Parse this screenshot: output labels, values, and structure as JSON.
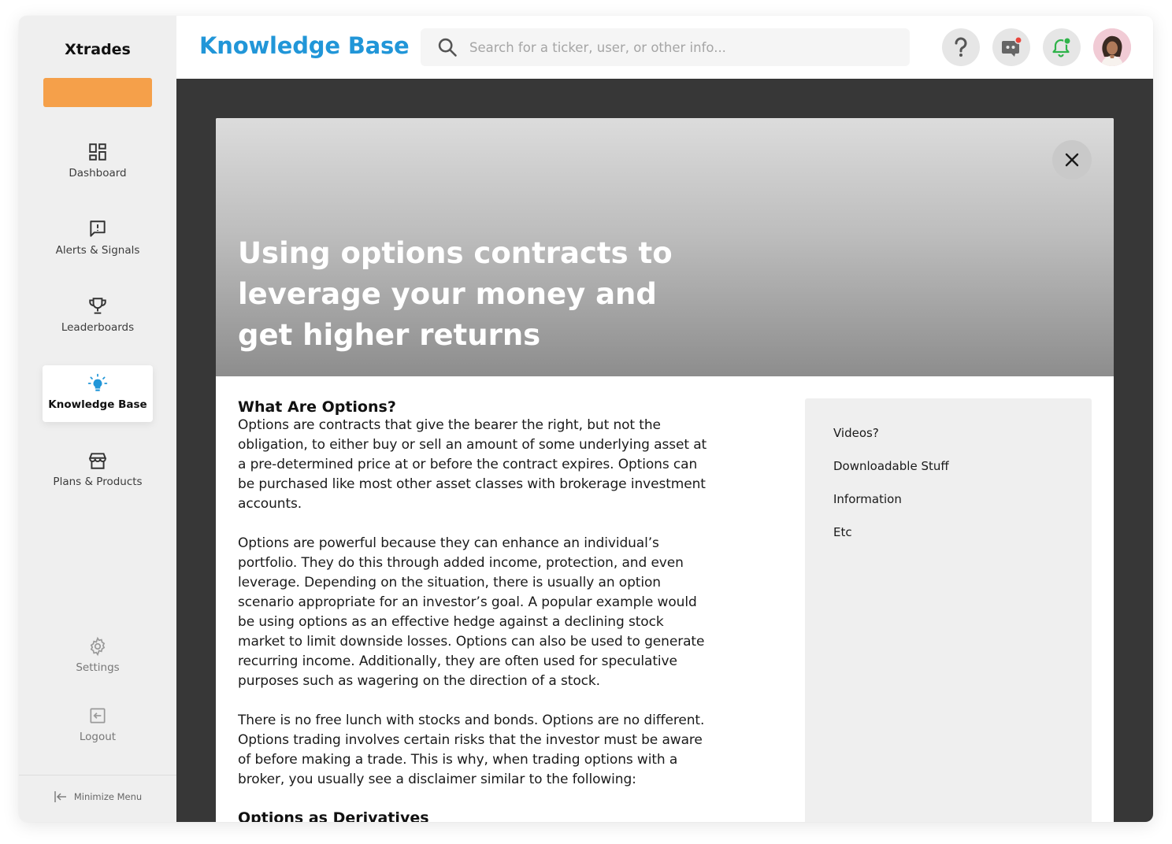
{
  "sidebar": {
    "brand": "Xtrades",
    "items": [
      {
        "label": "Dashboard",
        "icon": "dashboard-icon"
      },
      {
        "label": "Alerts & Signals",
        "icon": "alert-message-icon"
      },
      {
        "label": "Leaderboards",
        "icon": "trophy-icon"
      },
      {
        "label": "Knowledge Base",
        "icon": "lightbulb-icon",
        "active": true
      },
      {
        "label": "Plans & Products",
        "icon": "storefront-icon"
      },
      {
        "label": "Settings",
        "icon": "gear-icon"
      },
      {
        "label": "Logout",
        "icon": "logout-icon"
      }
    ],
    "minimize_label": "Minimize Menu"
  },
  "header": {
    "title": "Knowledge Base",
    "search_placeholder": "Search for a ticker, user, or other info...",
    "icons": [
      "help-icon",
      "discord-icon",
      "notification-bell-icon",
      "user-avatar"
    ]
  },
  "modal": {
    "title": "Using options contracts to leverage your money and get higher returns",
    "section_heading": "What Are Options?",
    "paragraphs": [
      "Options are contracts that give the bearer the right, but not the obligation, to either buy or sell an amount of some underlying asset at a pre-determined price at or before the contract expires. Options can be purchased like most other asset classes with brokerage investment accounts.",
      "Options are powerful because they can enhance an individual’s portfolio. They do this through added income, protection, and even leverage. Depending on the situation, there is usually an option scenario appropriate for an investor’s goal. A popular example would be using options as an effective hedge against a declining stock market to limit downside losses. Options can also be used to generate recurring income. Additionally, they are often used for speculative purposes such as wagering on the direction of a stock.",
      "There is no free lunch with stocks and bonds. Options are no different. Options trading involves certain risks that the investor must be aware of before making a trade. This is why, when trading options with a broker, you usually see a disclaimer similar to the following:"
    ],
    "subheading": "Options as Derivatives",
    "side_links": [
      "Videos?",
      "Downloadable Stuff",
      "Information",
      "Etc"
    ]
  },
  "colors": {
    "accent": "#2196d8",
    "orange": "#f5a04a",
    "sidebar_bg": "#efefef",
    "content_bg": "#373737",
    "notify_red": "#e8453c",
    "notify_green": "#2fb34a"
  }
}
